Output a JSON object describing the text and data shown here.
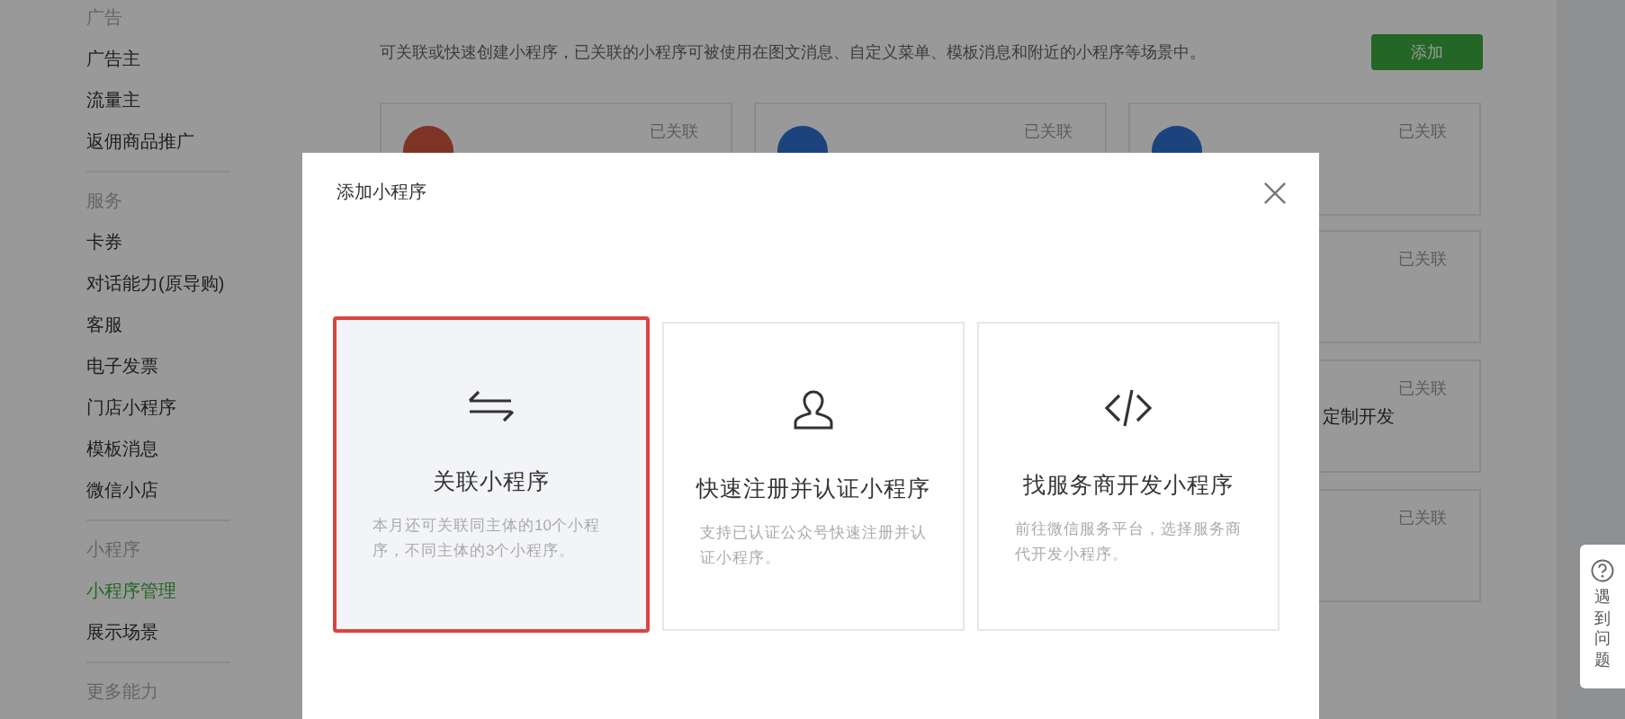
{
  "sidebar": {
    "sections": [
      {
        "title": "广告",
        "items": [
          {
            "label": "广告主",
            "selected": false
          },
          {
            "label": "流量主",
            "selected": false
          },
          {
            "label": "返佣商品推广",
            "selected": false
          }
        ]
      },
      {
        "title": "服务",
        "items": [
          {
            "label": "卡券",
            "selected": false
          },
          {
            "label": "对话能力(原导购)",
            "selected": false
          },
          {
            "label": "客服",
            "selected": false
          },
          {
            "label": "电子发票",
            "selected": false
          },
          {
            "label": "门店小程序",
            "selected": false
          },
          {
            "label": "模板消息",
            "selected": false
          },
          {
            "label": "微信小店",
            "selected": false
          }
        ]
      },
      {
        "title": "小程序",
        "items": [
          {
            "label": "小程序管理",
            "selected": true
          },
          {
            "label": "展示场景",
            "selected": false
          }
        ]
      },
      {
        "title": "更多能力"
      }
    ]
  },
  "main": {
    "description": "可关联或快速创建小程序，已关联的小程序可被使用在图文消息、自定义菜单、模板消息和附近的小程序等场景中。",
    "add_button": "添加",
    "top_row": [
      {
        "status": "已关联",
        "color": "#7e3425"
      },
      {
        "status": "已关联",
        "color": "#1c437d"
      },
      {
        "status": "已关联",
        "color": "#1c437d"
      }
    ],
    "right_column": [
      {
        "status": "已关联"
      },
      {
        "status": "已关联",
        "name": "定制开发"
      },
      {
        "status": "已关联"
      }
    ]
  },
  "modal": {
    "title": "添加小程序",
    "options": [
      {
        "kind": "link",
        "title": "关联小程序",
        "description": "本月还可关联同主体的10个小程序，不同主体的3个小程序。",
        "selected": true
      },
      {
        "kind": "user",
        "title": "快速注册并认证小程序",
        "description": "支持已认证公众号快速注册并认证小程序。",
        "selected": false
      },
      {
        "kind": "code",
        "title": "找服务商开发小程序",
        "description": "前往微信服务平台，选择服务商代开发小程序。",
        "selected": false
      }
    ]
  },
  "feedback": {
    "label": "遇到问题"
  }
}
